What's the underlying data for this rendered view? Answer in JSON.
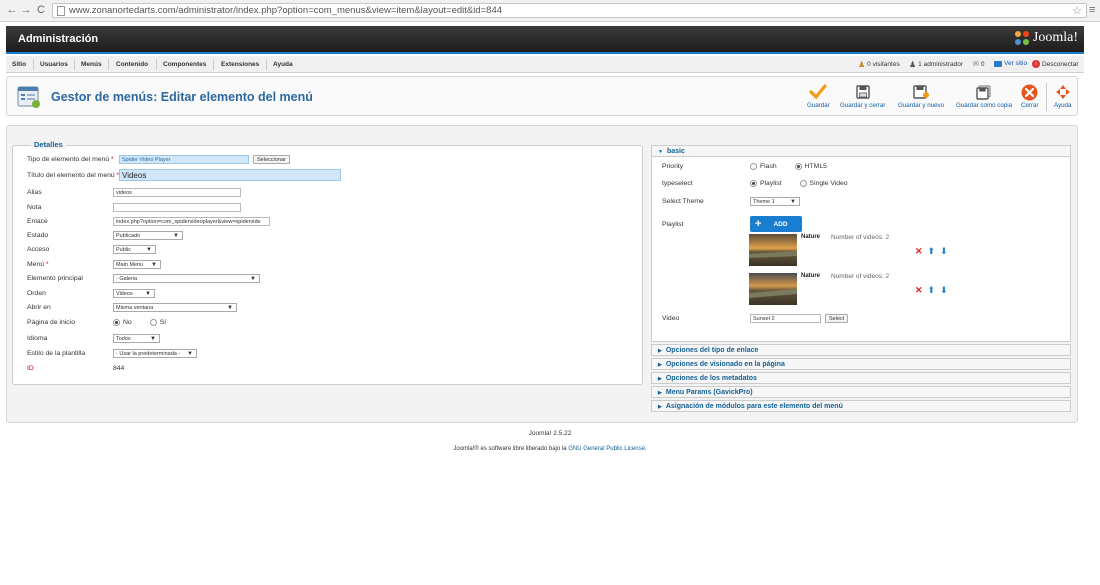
{
  "browser": {
    "url": "www.zonanortedarts.com/administrator/index.php?option=com_menus&view=item&layout=edit&id=844"
  },
  "header": {
    "title": "Administración",
    "logo_text": "Joomla!"
  },
  "menubar": {
    "items": [
      "Sitio",
      "Usuarios",
      "Menús",
      "Contenido",
      "Componentes",
      "Extensiones",
      "Ayuda"
    ],
    "status": {
      "visitors": "0 visitantes",
      "admins": "1 administrador",
      "messages": "0",
      "view_site": "Ver sitio",
      "logout": "Desconectar"
    }
  },
  "toolbar": {
    "page_title": "Gestor de menús: Editar elemento del menú",
    "buttons": [
      "Guardar",
      "Guardar y cerrar",
      "Guardar y nuevo",
      "Guardar como copia",
      "Cerrar",
      "Ayuda"
    ]
  },
  "details": {
    "legend": "Detalles",
    "type_label": "Tipo de elemento del menú",
    "type_value": "Spider Video Player",
    "select_label": "Seleccionar",
    "title_label": "Título del elemento del menú",
    "title_value": "Videos",
    "alias_label": "Alias",
    "alias_value": "videos",
    "note_label": "Nota",
    "note_value": "",
    "link_label": "Enlace",
    "link_value": "index.php?option=com_spidervideoplayer&view=spidervide",
    "status_label": "Estado",
    "status_value": "Publicado",
    "access_label": "Acceso",
    "access_value": "Public",
    "menu_label": "Menú",
    "menu_value": "Main Menu",
    "parent_label": "Elemento principal",
    "parent_value": "- Galeria",
    "order_label": "Orden",
    "order_value": "Videos",
    "open_label": "Abrir en",
    "open_value": "Misma ventana",
    "home_label": "Página de inicio",
    "home_no": "No",
    "home_yes": "Sí",
    "lang_label": "Idioma",
    "lang_value": "Todos",
    "style_label": "Estilo de la plantilla",
    "style_value": "- Usar la predeterminada -",
    "id_label": "ID",
    "id_value": "844"
  },
  "basic": {
    "title": "basic",
    "priority_label": "Priority",
    "priority_opt1": "Flash",
    "priority_opt2": "HTML5",
    "typeselect_label": "typeselect",
    "typeselect_opt1": "Playlist",
    "typeselect_opt2": "Single Video",
    "theme_label": "Select Theme",
    "theme_value": "Theme 1",
    "playlist_label": "Playlist",
    "add_label": "ADD",
    "playlist_items": [
      {
        "name": "Nature",
        "count": "Number of videos: 2"
      },
      {
        "name": "Nature",
        "count": "Number of videos: 2"
      }
    ],
    "video_label": "Video",
    "video_value": "Sunset 2",
    "video_select": "Select"
  },
  "panels": [
    "Opciones del tipo de enlace",
    "Opciones de visionado en la página",
    "Opciones de los metadatos",
    "Menu Params (GavickPro)",
    "Asignación de módulos para este elemento del menú"
  ],
  "footer": {
    "version": "Joomla! 2.5.22",
    "license_prefix": "Joomla!® es software libre liberado bajo la",
    "license_link": "GNU General Public License."
  }
}
